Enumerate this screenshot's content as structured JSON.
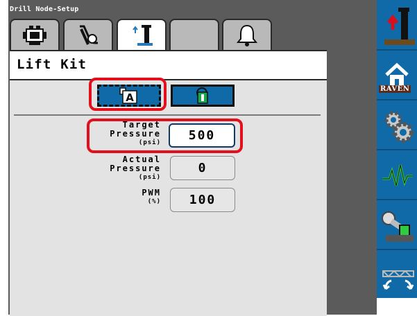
{
  "window": {
    "title": "Drill Node-Setup"
  },
  "tabs": [
    {
      "name": "tab-engine-setup",
      "icon": "engine-icon",
      "active": false
    },
    {
      "name": "tab-hydraulic-setup",
      "icon": "hydraulic-hose-icon",
      "active": false
    },
    {
      "name": "tab-lift-kit",
      "icon": "lift-kit-icon",
      "active": true
    },
    {
      "name": "tab-blank",
      "icon": "",
      "active": false
    },
    {
      "name": "tab-alarms",
      "icon": "bell-icon",
      "active": false
    }
  ],
  "page": {
    "title": "Lift Kit"
  },
  "mode_buttons": {
    "manual": {
      "icon": "manual-mode-icon",
      "glyph": "A"
    },
    "auto": {
      "icon": "auto-mode-icon"
    }
  },
  "fields": {
    "target_pressure": {
      "label_line1": "Target",
      "label_line2": "Pressure",
      "unit": "(psi)",
      "value": "500"
    },
    "actual_pressure": {
      "label_line1": "Actual",
      "label_line2": "Pressure",
      "unit": "(psi)",
      "value": "0"
    },
    "pwm": {
      "label_line1": "PWM",
      "unit": "(%)",
      "value": "100"
    }
  },
  "sidebar": {
    "items": [
      {
        "name": "sidebar-implement",
        "icon": "implement-lift-icon"
      },
      {
        "name": "sidebar-home",
        "icon": "home-icon",
        "brand": "RAVEN"
      },
      {
        "name": "sidebar-settings",
        "icon": "gears-icon"
      },
      {
        "name": "sidebar-diagnostics",
        "icon": "waveform-icon"
      },
      {
        "name": "sidebar-valve",
        "icon": "valve-lever-icon"
      },
      {
        "name": "sidebar-fold",
        "icon": "wing-fold-icon"
      }
    ]
  },
  "colors": {
    "accent_blue": "#0f6aa7",
    "highlight_red": "#e2101d",
    "panel_gray": "#5b5b5b",
    "content_gray": "#e3e3e3"
  }
}
